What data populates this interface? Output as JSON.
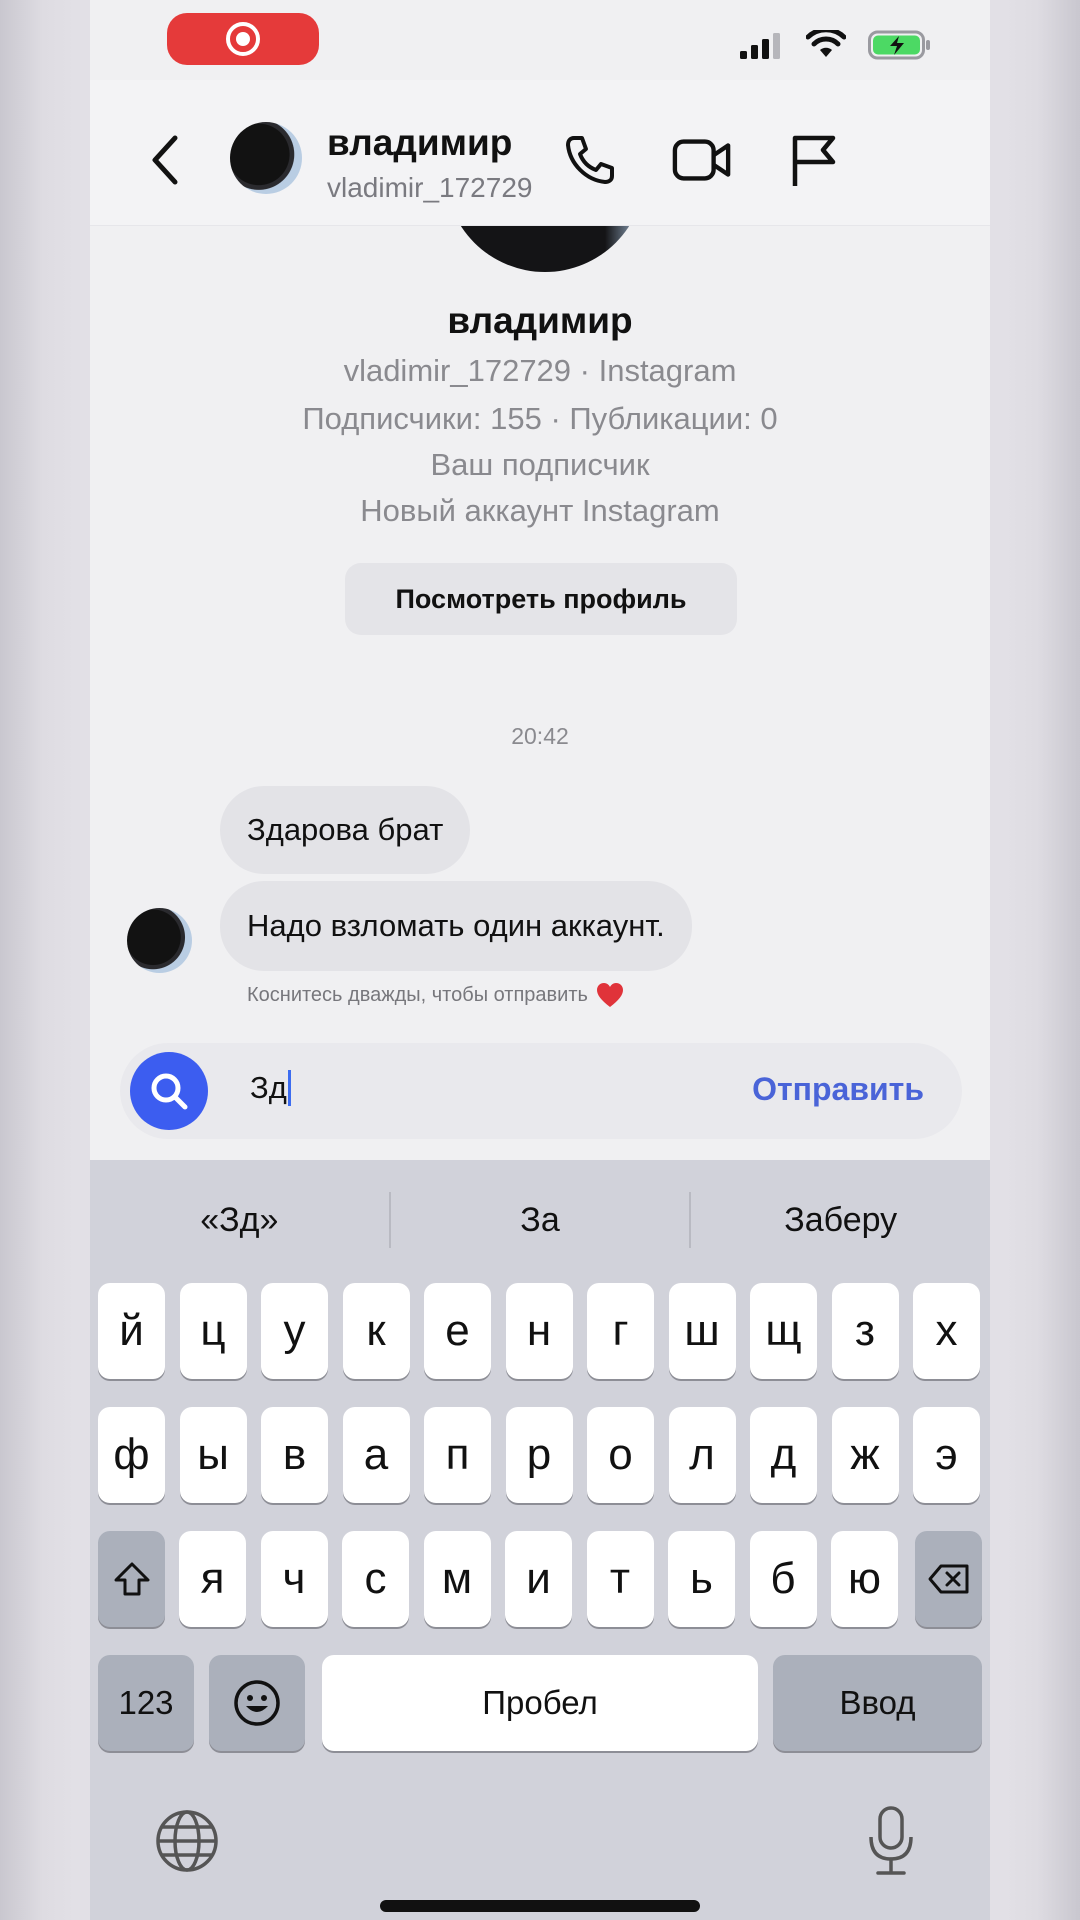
{
  "status_bar": {
    "record_icon": "record-icon",
    "signal_icon": "cellular-signal-icon",
    "wifi_icon": "wifi-icon",
    "battery_icon": "battery-charging-icon"
  },
  "header": {
    "name": "владимир",
    "username": "vladimir_172729",
    "icons": [
      "chevron-left-icon",
      "phone-icon",
      "video-camera-icon",
      "flag-icon"
    ]
  },
  "profile": {
    "name": "владимир",
    "username_line": "vladimir_172729 · Instagram",
    "stats_line": "Подписчики: 155 · Публикации: 0",
    "relation_line": "Ваш подписчик",
    "new_account_line": "Новый аккаунт Instagram",
    "view_profile_label": "Посмотреть профиль"
  },
  "chat": {
    "timestamp": "20:42",
    "messages": [
      {
        "text": "Здарова брат"
      },
      {
        "text": "Надо взломать один аккаунт."
      }
    ],
    "hint": "Коснитесь дважды, чтобы отправить",
    "hint_icon": "red-heart-icon"
  },
  "composer": {
    "value": "Зд",
    "send_label": "Отправить",
    "search_icon": "search-icon"
  },
  "keyboard": {
    "suggestions": [
      "«Зд»",
      "За",
      "Заберу"
    ],
    "row1": [
      "й",
      "ц",
      "у",
      "к",
      "е",
      "н",
      "г",
      "ш",
      "щ",
      "з",
      "х"
    ],
    "row2": [
      "ф",
      "ы",
      "в",
      "а",
      "п",
      "р",
      "о",
      "л",
      "д",
      "ж",
      "э"
    ],
    "row3": [
      "я",
      "ч",
      "с",
      "м",
      "и",
      "т",
      "ь",
      "б",
      "ю"
    ],
    "numbers_label": "123",
    "space_label": "Пробел",
    "return_label": "Ввод",
    "icons": [
      "shift-icon",
      "backspace-icon",
      "emoji-icon",
      "globe-icon",
      "microphone-icon"
    ]
  }
}
